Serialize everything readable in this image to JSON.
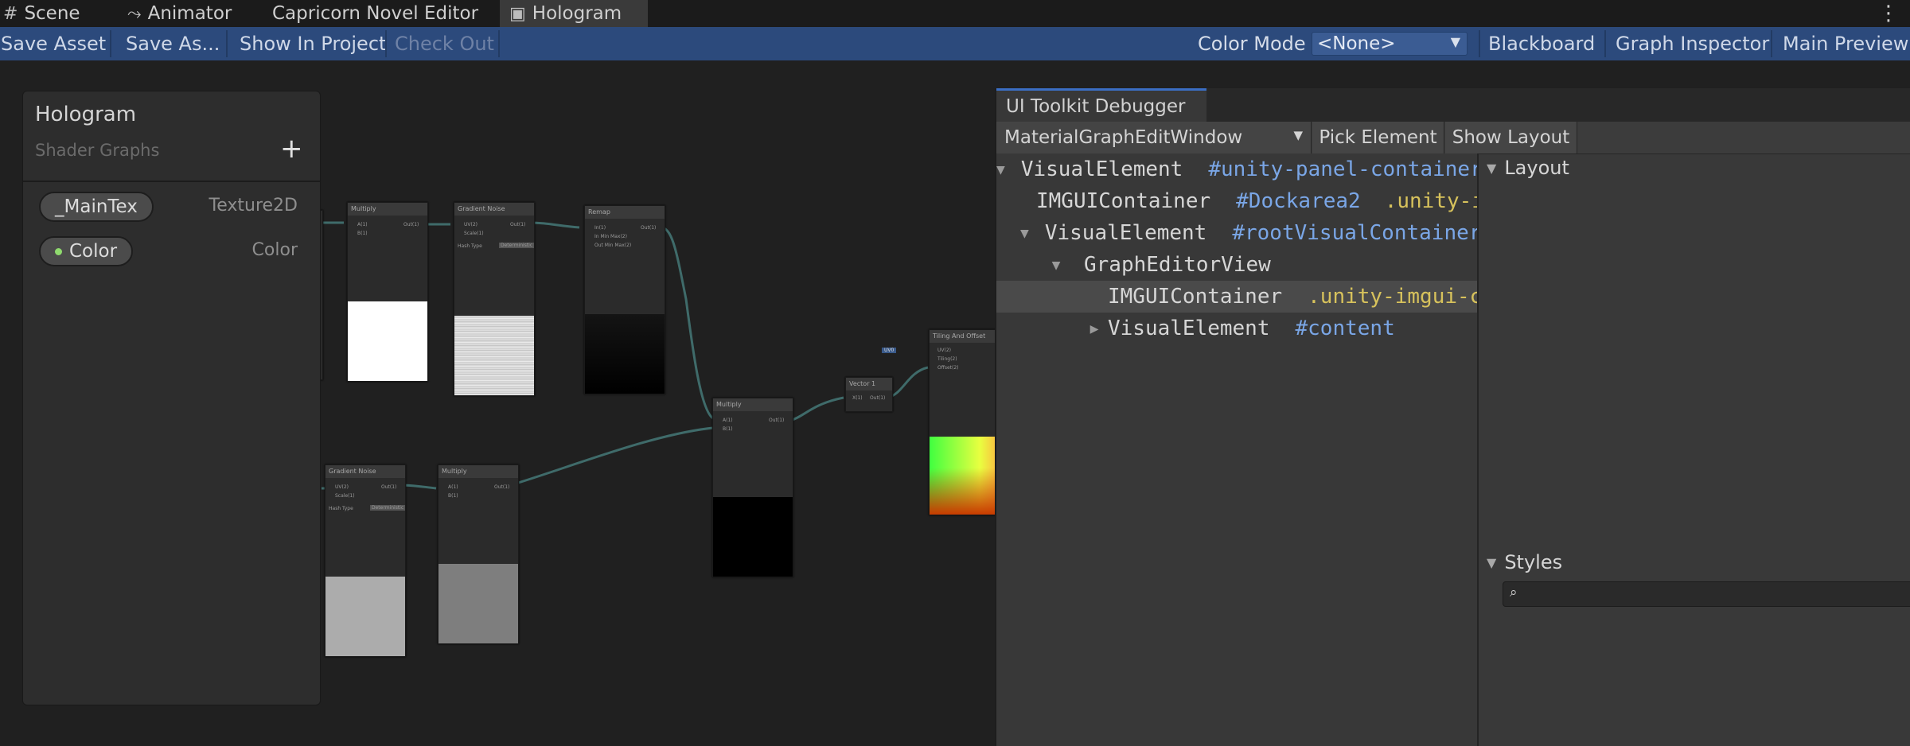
{
  "tabs": [
    {
      "label": "Scene",
      "icon": "grid-icon"
    },
    {
      "label": "Animator",
      "icon": "animator-icon"
    },
    {
      "label": "Capricorn Novel Editor",
      "icon": ""
    },
    {
      "label": "Hologram",
      "icon": "shader-graph-icon",
      "active": true
    }
  ],
  "toolbar": {
    "save_asset": "Save Asset",
    "save_as": "Save As...",
    "show_in_project": "Show In Project",
    "check_out": "Check Out",
    "color_mode_label": "Color Mode",
    "color_mode_value": "<None>",
    "blackboard": "Blackboard",
    "graph_inspector": "Graph Inspector",
    "main_preview": "Main Preview"
  },
  "blackboard": {
    "title": "Hologram",
    "subtitle": "Shader Graphs",
    "add_symbol": "+",
    "properties": [
      {
        "name": "_MainTex",
        "type": "Texture2D",
        "color": "#4b4b4b"
      },
      {
        "name": "Color",
        "type": "Color",
        "dot_color": "#8fda6e"
      }
    ]
  },
  "graph": {
    "nodes": [
      {
        "title": "Multiply",
        "ports": [
          "A(1)",
          "B(1)",
          "Out(1)"
        ]
      },
      {
        "title": "Gradient Noise",
        "ports": [
          "UV(2)",
          "Scale(1)",
          "Out(1)",
          "Hash Type",
          "Deterministic"
        ]
      },
      {
        "title": "Remap",
        "ports": [
          "In(1)",
          "In Min Max(2)",
          "Out Min Max(2)",
          "Out(1)"
        ]
      },
      {
        "title": "Gradient Noise",
        "ports": [
          "UV(2)",
          "Scale(1)",
          "Out(1)",
          "Hash Type",
          "Deterministic"
        ]
      },
      {
        "title": "Multiply",
        "ports": [
          "A(1)",
          "B(1)",
          "Out(1)"
        ]
      },
      {
        "title": "Multiply",
        "ports": [
          "A(1)",
          "B(1)",
          "Out(1)"
        ]
      },
      {
        "title": "Vector 1",
        "ports": [
          "X(1)",
          "Out(1)"
        ]
      },
      {
        "title": "Tiling And Offset",
        "ports": [
          "UV(2)",
          "Tiling(2)",
          "Offset(2)",
          "UV0"
        ]
      }
    ],
    "wire_color": "#3f6b6a"
  },
  "debugger": {
    "tab": "UI Toolkit Debugger",
    "panel_select": "MaterialGraphEditWindow",
    "pick_element": "Pick Element",
    "show_layout": "Show Layout",
    "tree": [
      {
        "tri": "▼",
        "element": "VisualElement",
        "id": "#unity-panel-container",
        "cls": ""
      },
      {
        "tri": "",
        "element": "IMGUIContainer",
        "id": "#Dockarea2",
        "cls": ".unity-imgui-container"
      },
      {
        "tri": "▼",
        "element": "VisualElement",
        "id": "#rootVisualContainer",
        "cls": ""
      },
      {
        "tri": "▼",
        "element": "GraphEditorView",
        "id": "",
        "cls": ""
      },
      {
        "tri": "",
        "element": "IMGUIContainer",
        "id": "",
        "cls": ".unity-imgui-container",
        "selected": true
      },
      {
        "tri": "▶",
        "element": "VisualElement",
        "id": "#content",
        "cls": ""
      }
    ],
    "layout_header": "Layout",
    "styles_header": "Styles"
  }
}
